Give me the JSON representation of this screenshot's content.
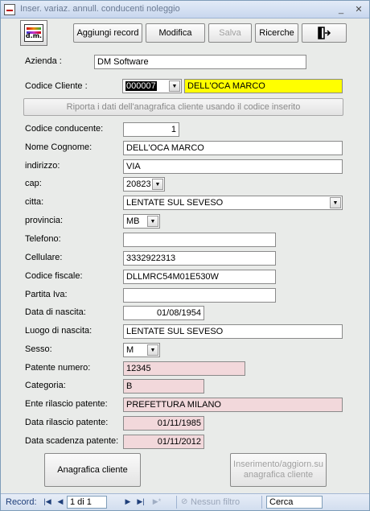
{
  "window": {
    "title": "Inser. variaz. annull. conducenti noleggio"
  },
  "toolbar": {
    "logo_text": "d.m.",
    "add_record": "Aggiungi record",
    "modify": "Modifica",
    "save": "Salva",
    "search": "Ricerche",
    "exit_icon": "exit-door-icon"
  },
  "form": {
    "azienda_label": "Azienda :",
    "azienda_value": "DM Software",
    "codice_cliente_label": "Codice Cliente :",
    "codice_cliente_value": "000007",
    "cliente_name": "DELL'OCA MARCO",
    "reload_button": "Riporta i dati dell'anagrafica cliente usando il codice inserito",
    "codice_conducente_label": "Codice conducente:",
    "codice_conducente_value": "1",
    "nome_label": "Nome Cognome:",
    "nome_value": "DELL'OCA MARCO",
    "indirizzo_label": "indirizzo:",
    "indirizzo_value": "VIA",
    "cap_label": "cap:",
    "cap_value": "20823",
    "citta_label": "citta:",
    "citta_value": "LENTATE SUL SEVESO",
    "provincia_label": "provincia:",
    "provincia_value": "MB",
    "telefono_label": "Telefono:",
    "telefono_value": "",
    "cellulare_label": "Cellulare:",
    "cellulare_value": "3332922313",
    "codice_fiscale_label": "Codice fiscale:",
    "codice_fiscale_value": "DLLMRC54M01E530W",
    "partita_iva_label": "Partita Iva:",
    "partita_iva_value": "",
    "data_nascita_label": "Data di nascita:",
    "data_nascita_value": "01/08/1954",
    "luogo_nascita_label": "Luogo di nascita:",
    "luogo_nascita_value": "LENTATE SUL SEVESO",
    "sesso_label": "Sesso:",
    "sesso_value": "M",
    "patente_numero_label": "Patente numero:",
    "patente_numero_value": "12345",
    "categoria_label": "Categoria:",
    "categoria_value": "B",
    "ente_label": "Ente rilascio patente:",
    "ente_value": "PREFETTURA MILANO",
    "data_rilascio_label": "Data rilascio patente:",
    "data_rilascio_value": "01/11/1985",
    "data_scadenza_label": "Data scadenza patente:",
    "data_scadenza_value": "01/11/2012"
  },
  "buttons": {
    "anagrafica": "Anagrafica cliente",
    "inserimento": "Inserimento/aggiorn.su anagrafica cliente"
  },
  "navbar": {
    "record_label": "Record:",
    "position": "1 di 1",
    "filter_label": "Nessun filtro",
    "search_value": "Cerca"
  },
  "colors": {
    "pink_field": "#f2d8db",
    "highlight_yellow": "#ffff00",
    "window_bg": "#e9ebe9"
  }
}
